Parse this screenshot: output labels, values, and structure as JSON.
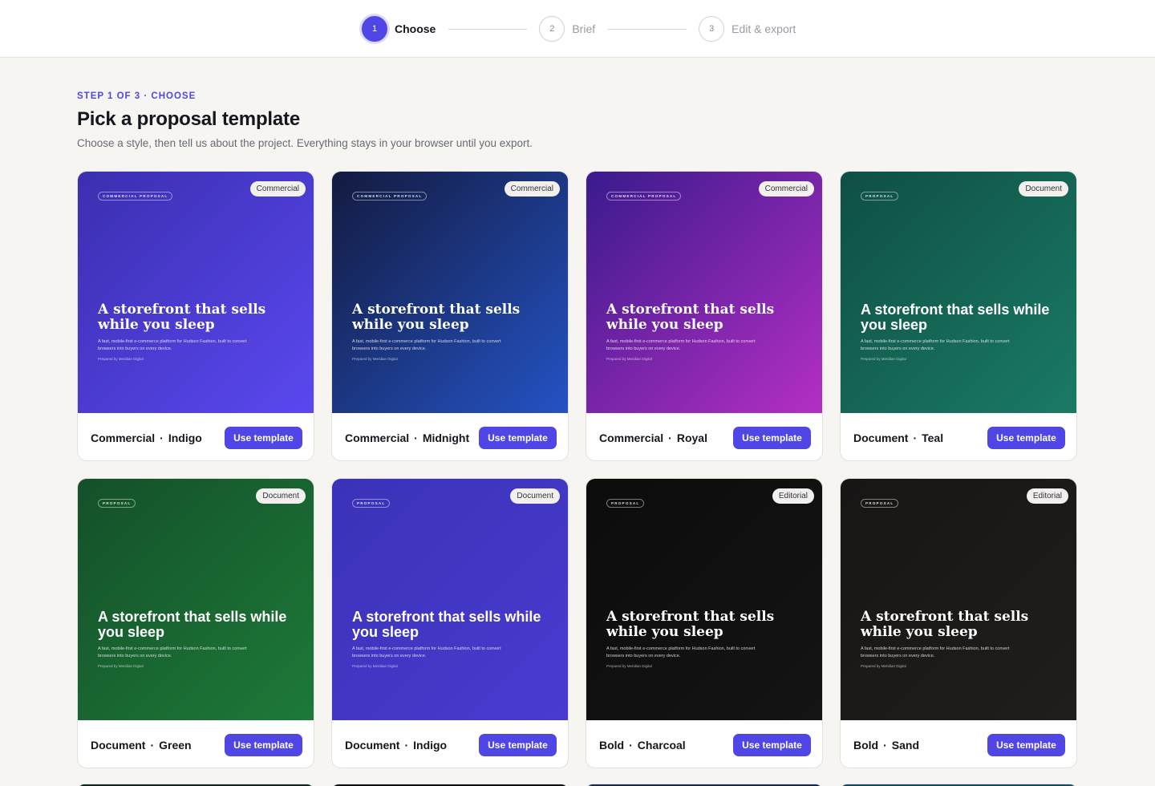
{
  "stepper": {
    "steps": [
      {
        "num": "1",
        "label": "Choose"
      },
      {
        "num": "2",
        "label": "Brief"
      },
      {
        "num": "3",
        "label": "Edit & export"
      }
    ]
  },
  "header": {
    "eyebrow": "STEP 1 OF 3 · CHOOSE",
    "title": "Pick a proposal template",
    "subtitle": "Choose a style, then tell us about the project. Everything stays in your browser until you export."
  },
  "preview": {
    "headline": "A storefront that sells while you sleep",
    "blurb": "A fast, mobile-first e-commerce platform for Hudson Fashion, built to convert browsers into buyers on every device.",
    "prepared": "Prepared by Meridian Digital"
  },
  "dot": "·",
  "use_label": "Use template",
  "cards": [
    {
      "family": "Commercial",
      "variant": "Indigo",
      "badge": "Commercial",
      "chip": "COMMERCIAL PROPOSAL",
      "bg1": "#3b2fb0",
      "bg2": "#5a48f0"
    },
    {
      "family": "Commercial",
      "variant": "Midnight",
      "badge": "Commercial",
      "chip": "COMMERCIAL PROPOSAL",
      "bg1": "#131a40",
      "bg2": "#2453c4"
    },
    {
      "family": "Commercial",
      "variant": "Royal",
      "badge": "Commercial",
      "chip": "COMMERCIAL PROPOSAL",
      "bg1": "#3a1a8e",
      "bg2": "#b42fc4"
    },
    {
      "family": "Document",
      "variant": "Teal",
      "badge": "Document",
      "chip": "PROPOSAL",
      "bg1": "#0f4f45",
      "bg2": "#1a7a64"
    },
    {
      "family": "Document",
      "variant": "Green",
      "badge": "Document",
      "chip": "PROPOSAL",
      "bg1": "#14502a",
      "bg2": "#1d7a38"
    },
    {
      "family": "Document",
      "variant": "Indigo",
      "badge": "Document",
      "chip": "PROPOSAL",
      "bg1": "#3a32b8",
      "bg2": "#4a3bd0"
    },
    {
      "family": "Bold",
      "variant": "Charcoal",
      "badge": "Editorial",
      "chip": "PROPOSAL",
      "bg1": "#0c0c0c",
      "bg2": "#141414"
    },
    {
      "family": "Bold",
      "variant": "Sand",
      "badge": "Editorial",
      "chip": "PROPOSAL",
      "bg1": "#171615",
      "bg2": "#201e1c"
    }
  ],
  "peek_colors": [
    "#0c2a20",
    "#111111",
    "#0e2a5a",
    "#0e4a6a"
  ]
}
